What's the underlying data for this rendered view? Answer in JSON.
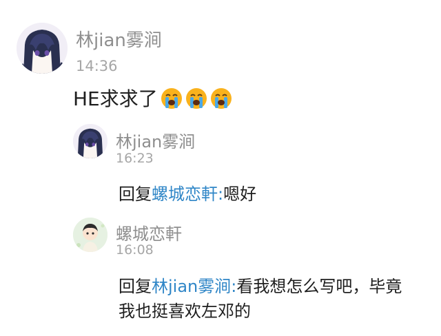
{
  "comment": {
    "username": "林jian雾涧",
    "time": "14:36",
    "text": "HE求求了",
    "emoji": [
      "loudly-crying-face-icon",
      "loudly-crying-face-icon",
      "loudly-crying-face-icon"
    ]
  },
  "replies": [
    {
      "username": "林jian雾涧",
      "time": "16:23",
      "prefix": "回复",
      "target": "螺城恋軒:",
      "text": "嗯好"
    },
    {
      "username": "螺城恋軒",
      "time": "16:08",
      "prefix": "回复",
      "target": "林jian雾涧:",
      "text": "看我想怎么写吧，毕竟",
      "text_line2": "我也挺喜欢左邓的"
    }
  ]
}
